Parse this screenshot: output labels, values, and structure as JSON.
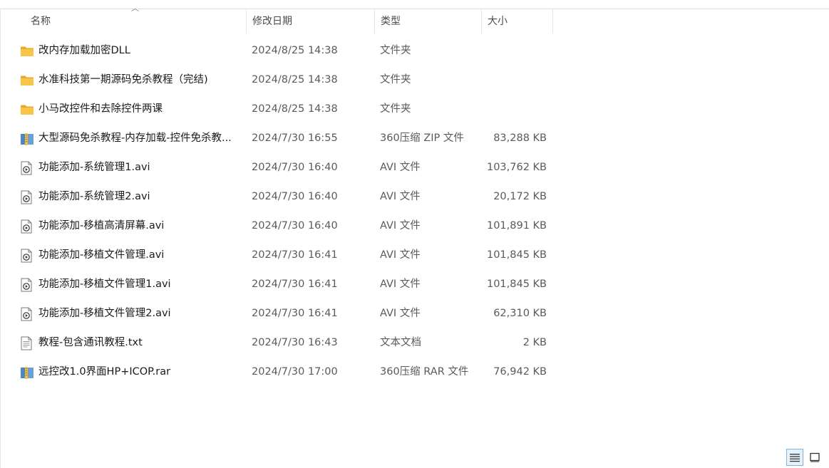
{
  "columns": {
    "name": "名称",
    "date": "修改日期",
    "type": "类型",
    "size": "大小"
  },
  "files": [
    {
      "icon": "folder-icon",
      "name": "改内存加载加密DLL",
      "date": "2024/8/25 14:38",
      "type": "文件夹",
      "size": ""
    },
    {
      "icon": "folder-icon",
      "name": "水准科技第一期源码免杀教程（完结)",
      "date": "2024/8/25 14:38",
      "type": "文件夹",
      "size": ""
    },
    {
      "icon": "folder-icon",
      "name": "小马改控件和去除控件两课",
      "date": "2024/8/25 14:38",
      "type": "文件夹",
      "size": ""
    },
    {
      "icon": "archive-icon",
      "name": "大型源码免杀教程-内存加载-控件免杀教...",
      "date": "2024/7/30 16:55",
      "type": "360压缩 ZIP 文件",
      "size": "83,288 KB"
    },
    {
      "icon": "video-file-icon",
      "name": "功能添加-系统管理1.avi",
      "date": "2024/7/30 16:40",
      "type": "AVI 文件",
      "size": "103,762 KB"
    },
    {
      "icon": "video-file-icon",
      "name": "功能添加-系统管理2.avi",
      "date": "2024/7/30 16:40",
      "type": "AVI 文件",
      "size": "20,172 KB"
    },
    {
      "icon": "video-file-icon",
      "name": "功能添加-移植高清屏幕.avi",
      "date": "2024/7/30 16:40",
      "type": "AVI 文件",
      "size": "101,891 KB"
    },
    {
      "icon": "video-file-icon",
      "name": "功能添加-移植文件管理.avi",
      "date": "2024/7/30 16:41",
      "type": "AVI 文件",
      "size": "101,845 KB"
    },
    {
      "icon": "video-file-icon",
      "name": "功能添加-移植文件管理1.avi",
      "date": "2024/7/30 16:41",
      "type": "AVI 文件",
      "size": "101,845 KB"
    },
    {
      "icon": "video-file-icon",
      "name": "功能添加-移植文件管理2.avi",
      "date": "2024/7/30 16:41",
      "type": "AVI 文件",
      "size": "62,310 KB"
    },
    {
      "icon": "text-file-icon",
      "name": "教程-包含通讯教程.txt",
      "date": "2024/7/30 16:43",
      "type": "文本文档",
      "size": "2 KB"
    },
    {
      "icon": "archive-icon",
      "name": "远控改1.0界面HP+ICOP.rar",
      "date": "2024/7/30 17:00",
      "type": "360压缩 RAR 文件",
      "size": "76,942 KB"
    }
  ],
  "colors": {
    "folder": "#f7c548",
    "folder_dark": "#e6a92a",
    "archive_blue": "#4a86c8",
    "archive_yellow": "#f5c242",
    "view_active_border": "#7fb3e6"
  },
  "viewbar": {
    "details_icon": "details-view-icon",
    "tiles_icon": "large-icons-view-icon"
  }
}
